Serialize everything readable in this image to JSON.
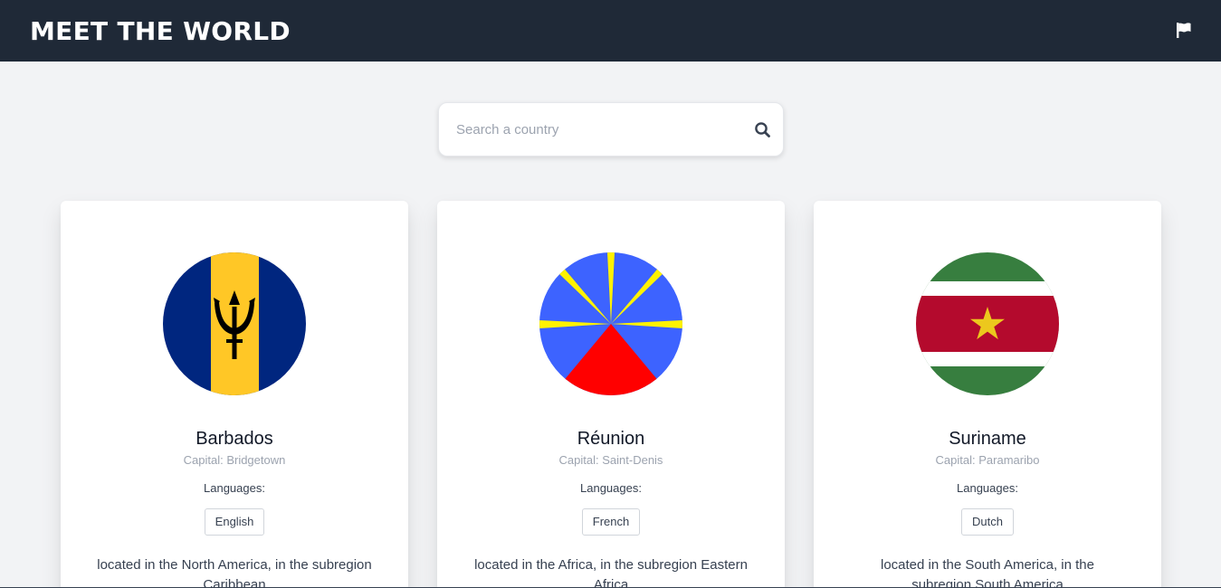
{
  "header": {
    "title": "MEET THE WORLD",
    "flag_icon": "flag-icon"
  },
  "search": {
    "placeholder": "Search a country",
    "value": "",
    "icon": "search-icon"
  },
  "colors": {
    "header_bg": "#1f2937",
    "page_bg": "#f2f3f5",
    "card_bg": "#ffffff",
    "muted_text": "#9ca3af"
  },
  "countries": [
    {
      "name": "Barbados",
      "capital": "Capital: Bridgetown",
      "languages_label": "Languages:",
      "languages": [
        "English"
      ],
      "description": "located in the North America, in the subregion Caribbean",
      "flag_icon": "barbados-flag-icon"
    },
    {
      "name": "Réunion",
      "capital": "Capital: Saint-Denis",
      "languages_label": "Languages:",
      "languages": [
        "French"
      ],
      "description": "located in the Africa, in the subregion Eastern Africa",
      "flag_icon": "reunion-flag-icon"
    },
    {
      "name": "Suriname",
      "capital": "Capital: Paramaribo",
      "languages_label": "Languages:",
      "languages": [
        "Dutch"
      ],
      "description": "located in the South America, in the subregion South America",
      "flag_icon": "suriname-flag-icon"
    }
  ]
}
